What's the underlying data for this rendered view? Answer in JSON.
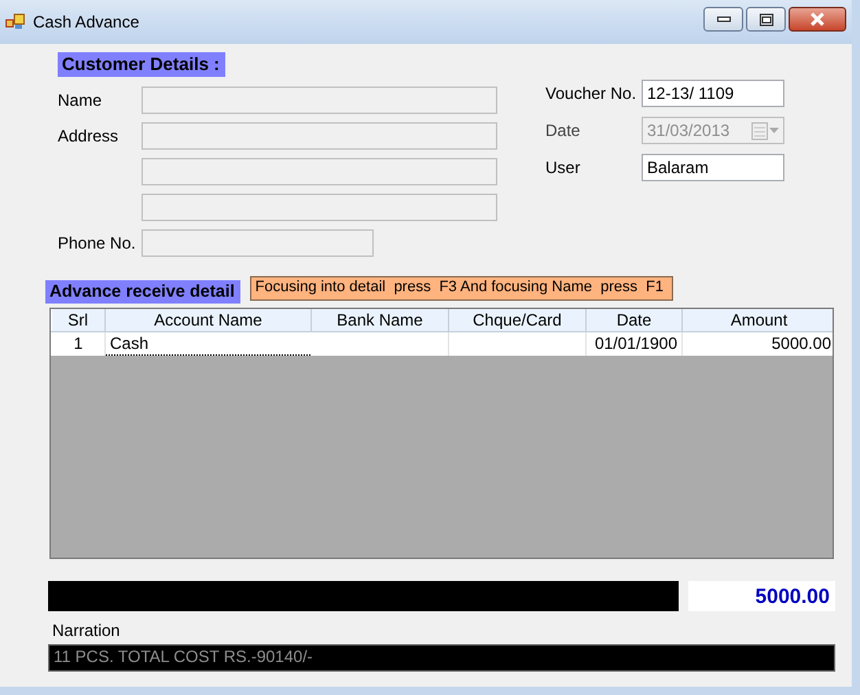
{
  "window": {
    "title": "Cash Advance"
  },
  "customer_details": {
    "heading": "Customer Details :",
    "fields": [
      {
        "kind": "text",
        "label": "Name",
        "disabled": true
      },
      {
        "kind": "text",
        "label": "Address",
        "disabled": true
      },
      {
        "kind": "continuation",
        "disabled": true
      },
      {
        "kind": "continuation",
        "disabled": true
      },
      {
        "kind": "short",
        "label": "Phone No.",
        "disabled": true
      }
    ]
  },
  "voucher": {
    "fields": [
      {
        "kind": "text",
        "label": "Voucher No.",
        "value": "12-13/  1109",
        "disabled": false
      },
      {
        "kind": "date",
        "label": "Date",
        "value": "31/03/2013",
        "disabled": true
      },
      {
        "kind": "text",
        "label": "User",
        "value": "Balaram",
        "disabled": false
      }
    ]
  },
  "detail": {
    "heading": "Advance receive detail",
    "hint": "Focusing into detail  press  F3 And focusing Name  press  F1",
    "columns": [
      "Srl",
      "Account Name",
      "Bank Name",
      "Chque/Card",
      "Date",
      "Amount"
    ],
    "rows": [
      {
        "cells": [
          {
            "text": "1",
            "focused": false
          },
          {
            "text": "Cash",
            "focused": true
          },
          {
            "focused": false
          },
          {
            "focused": false
          },
          {
            "text": "01/01/1900",
            "focused": false
          },
          {
            "text": "5000.00",
            "focused": false
          }
        ]
      }
    ]
  },
  "total": "5000.00",
  "narration": {
    "label": "Narration",
    "value": "11 PCS. TOTAL COST RS.-90140/-"
  }
}
